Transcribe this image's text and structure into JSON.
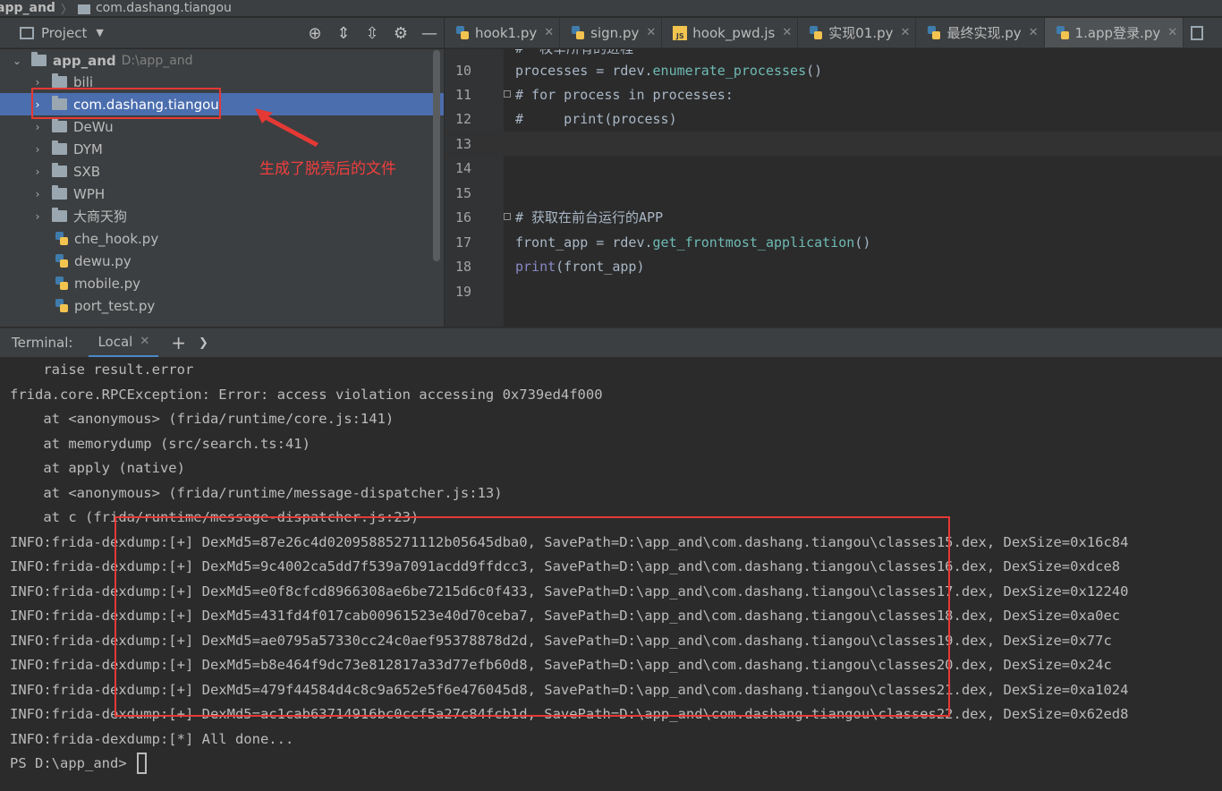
{
  "breadcrumb": {
    "root": "app_and",
    "folder": "com.dashang.tiangou"
  },
  "project_panel": {
    "title": "Project",
    "tree": [
      {
        "label": "app_and",
        "path": "D:\\app_and",
        "type": "folder",
        "expanded": true,
        "level": 0
      },
      {
        "label": "bili",
        "type": "folder",
        "level": 1
      },
      {
        "label": "com.dashang.tiangou",
        "type": "folder",
        "level": 1,
        "selected": true
      },
      {
        "label": "DeWu",
        "type": "folder",
        "level": 1
      },
      {
        "label": "DYM",
        "type": "folder",
        "level": 1
      },
      {
        "label": "SXB",
        "type": "folder",
        "level": 1
      },
      {
        "label": "WPH",
        "type": "folder",
        "level": 1
      },
      {
        "label": "大商天狗",
        "type": "folder",
        "level": 1
      },
      {
        "label": "che_hook.py",
        "type": "py",
        "level": 1
      },
      {
        "label": "dewu.py",
        "type": "py",
        "level": 1
      },
      {
        "label": "mobile.py",
        "type": "py",
        "level": 1
      },
      {
        "label": "port_test.py",
        "type": "py",
        "level": 1
      }
    ]
  },
  "editor_tabs": [
    {
      "label": "hook1.py",
      "icon": "python-file-icon"
    },
    {
      "label": "sign.py",
      "icon": "python-file-icon"
    },
    {
      "label": "hook_pwd.js",
      "icon": "js-file-icon"
    },
    {
      "label": "实现01.py",
      "icon": "python-file-icon"
    },
    {
      "label": "最终实现.py",
      "icon": "python-file-icon"
    },
    {
      "label": "1.app登录.py",
      "icon": "python-file-icon",
      "active": true
    }
  ],
  "editor": {
    "lines": [
      {
        "num": "10",
        "code": "processes = rdev.enumerate_processes()"
      },
      {
        "num": "11",
        "code": "# for process in processes:"
      },
      {
        "num": "12",
        "code": "#     print(process)"
      },
      {
        "num": "13",
        "code": ""
      },
      {
        "num": "14",
        "code": ""
      },
      {
        "num": "15",
        "code": ""
      },
      {
        "num": "16",
        "code": "# 获取在前台运行的APP"
      },
      {
        "num": "17",
        "code": "front_app = rdev.get_frontmost_application()"
      },
      {
        "num": "18",
        "code": "print(front_app)"
      },
      {
        "num": "19",
        "code": ""
      }
    ]
  },
  "terminal": {
    "label": "Terminal:",
    "tab": "Local",
    "lines": [
      "    raise result.error",
      "frida.core.RPCException: Error: access violation accessing 0x739ed4f000",
      "    at <anonymous> (frida/runtime/core.js:141)",
      "    at memorydump (src/search.ts:41)",
      "    at apply (native)",
      "    at <anonymous> (frida/runtime/message-dispatcher.js:13)",
      "    at c (frida/runtime/message-dispatcher.js:23)",
      "INFO:frida-dexdump:[+] DexMd5=87e26c4d02095885271112b05645dba0, SavePath=D:\\app_and\\com.dashang.tiangou\\classes15.dex, DexSize=0x16c84",
      "INFO:frida-dexdump:[+] DexMd5=9c4002ca5dd7f539a7091acdd9ffdcc3, SavePath=D:\\app_and\\com.dashang.tiangou\\classes16.dex, DexSize=0xdce8",
      "INFO:frida-dexdump:[+] DexMd5=e0f8cfcd8966308ae6be7215d6c0f433, SavePath=D:\\app_and\\com.dashang.tiangou\\classes17.dex, DexSize=0x12240",
      "INFO:frida-dexdump:[+] DexMd5=431fd4f017cab00961523e40d70ceba7, SavePath=D:\\app_and\\com.dashang.tiangou\\classes18.dex, DexSize=0xa0ec",
      "INFO:frida-dexdump:[+] DexMd5=ae0795a57330cc24c0aef95378878d2d, SavePath=D:\\app_and\\com.dashang.tiangou\\classes19.dex, DexSize=0x77c",
      "INFO:frida-dexdump:[+] DexMd5=b8e464f9dc73e812817a33d77efb60d8, SavePath=D:\\app_and\\com.dashang.tiangou\\classes20.dex, DexSize=0x24c",
      "INFO:frida-dexdump:[+] DexMd5=479f44584d4c8c9a652e5f6e476045d8, SavePath=D:\\app_and\\com.dashang.tiangou\\classes21.dex, DexSize=0xa1024",
      "INFO:frida-dexdump:[+] DexMd5=ac1cab63714916bc0ccf5a27c84fcb1d, SavePath=D:\\app_and\\com.dashang.tiangou\\classes22.dex, DexSize=0x62ed8",
      "INFO:frida-dexdump:[*] All done...",
      "PS D:\\app_and> "
    ]
  },
  "annotation": {
    "text": "生成了脱壳后的文件",
    "color": "#e53935"
  },
  "colors": {
    "selection": "#4b6eaf",
    "panel": "#3c3f41",
    "editor_bg": "#2b2b2b",
    "annotation_red": "#e53935"
  }
}
